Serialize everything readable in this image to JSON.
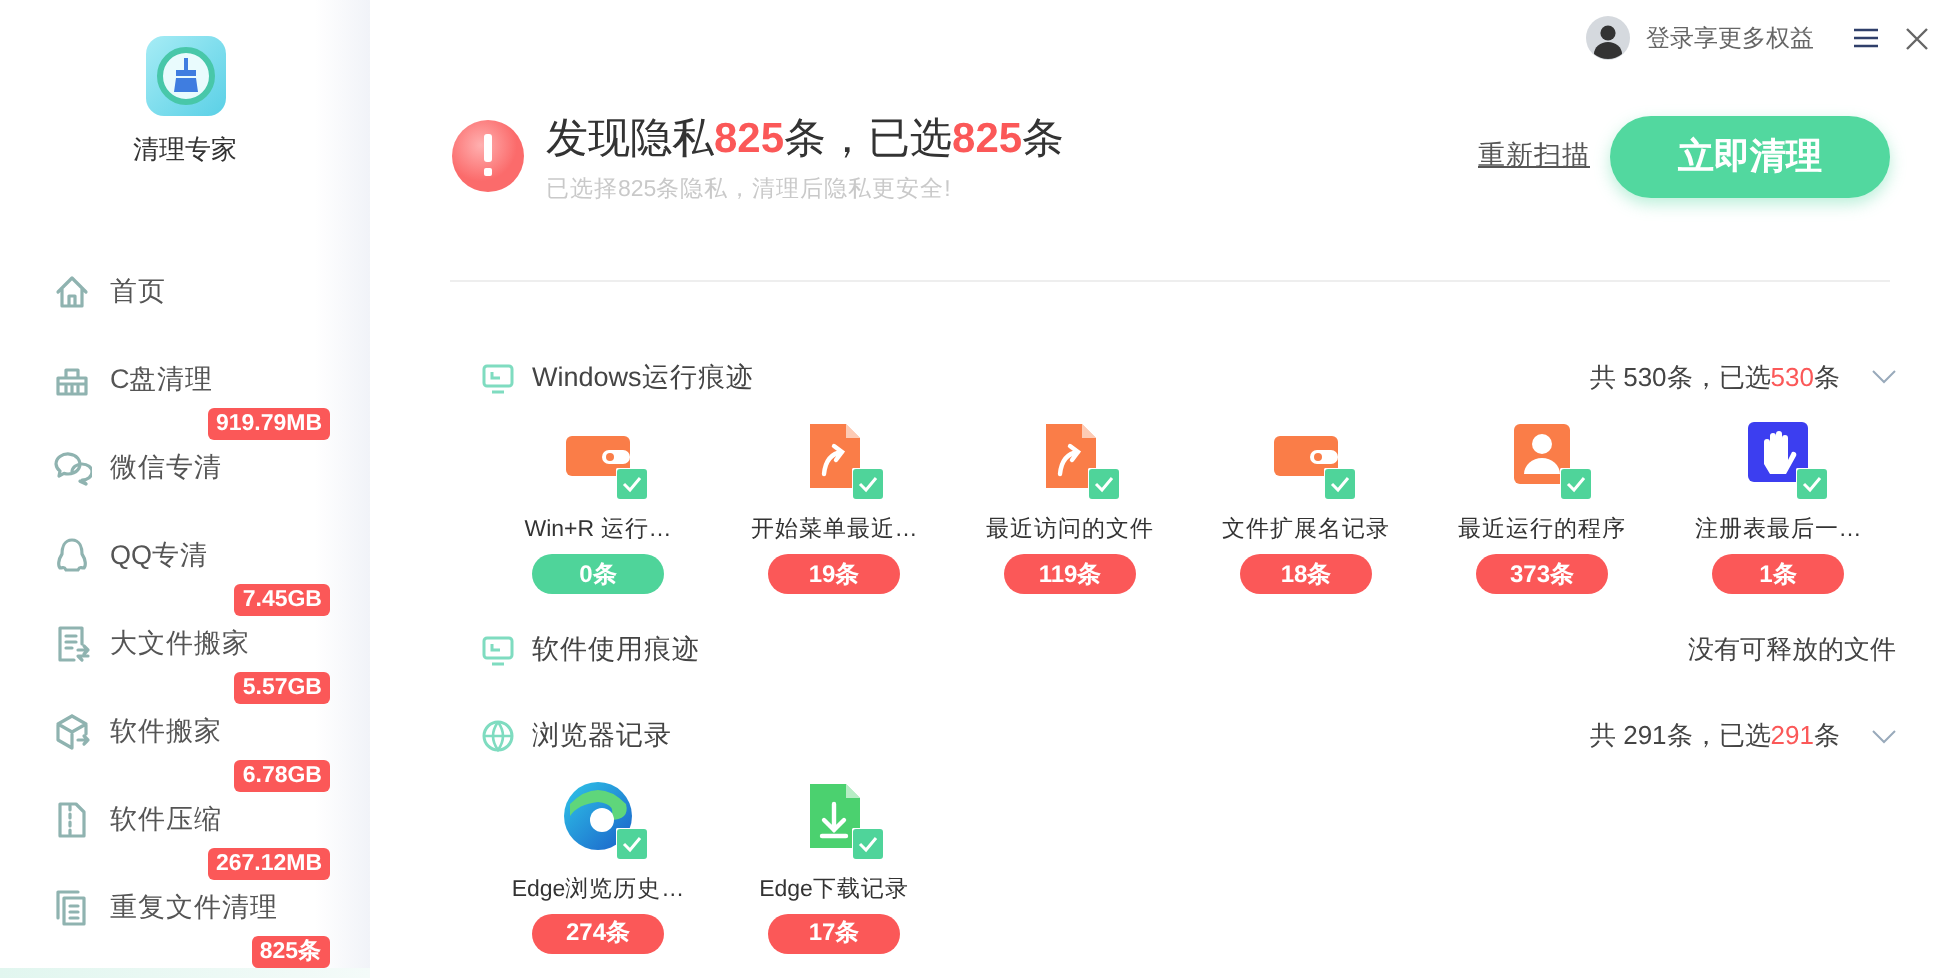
{
  "app": {
    "name": "清理专家"
  },
  "sidebar": {
    "items": [
      {
        "label": "首页",
        "selected": false
      },
      {
        "label": "C盘清理",
        "selected": false
      },
      {
        "label": "微信专清",
        "badge": "919.79MB",
        "selected": false
      },
      {
        "label": "QQ专清",
        "selected": false
      },
      {
        "label": "大文件搬家",
        "badge": "7.45GB",
        "selected": false
      },
      {
        "label": "软件搬家",
        "badge": "5.57GB",
        "selected": false
      },
      {
        "label": "软件压缩",
        "badge": "6.78GB",
        "selected": false
      },
      {
        "label": "重复文件清理",
        "badge": "267.12MB",
        "selected": false
      },
      {
        "badge": "825条",
        "selected": true
      }
    ]
  },
  "top_bar": {
    "login": "登录享更多权益"
  },
  "summary": {
    "title": [
      {
        "kind": "plain",
        "text": "发现隐私"
      },
      {
        "kind": "count",
        "text": "825"
      },
      {
        "kind": "plain",
        "text": "条，已选"
      },
      {
        "kind": "count",
        "text": "825"
      },
      {
        "kind": "plain",
        "text": "条"
      }
    ],
    "subtitle": "已选择825条隐私，清理后隐私更安全!",
    "rescan": "重新扫描",
    "clean": "立即清理"
  },
  "sections": [
    {
      "title": "Windows运行痕迹",
      "status": [
        {
          "kind": "plain",
          "text": "共 530条，已选"
        },
        {
          "kind": "count",
          "text": "530"
        },
        {
          "kind": "plain",
          "text": "条"
        }
      ],
      "items": [
        {
          "label": "Win+R 运行…",
          "checked": true,
          "count": "0条",
          "color": "#4fd49a"
        },
        {
          "label": "开始菜单最近…",
          "checked": true,
          "count": "19条",
          "color": "#fb5858"
        },
        {
          "label": "最近访问的文件",
          "checked": true,
          "count": "119条",
          "color": "#fb5858"
        },
        {
          "label": "文件扩展名记录",
          "checked": true,
          "count": "18条",
          "color": "#fb5858"
        },
        {
          "label": "最近运行的程序",
          "checked": true,
          "count": "373条",
          "color": "#fb5858"
        },
        {
          "label": "注册表最后一…",
          "checked": true,
          "count": "1条",
          "color": "#fb5858"
        }
      ]
    },
    {
      "title": "软件使用痕迹",
      "status": [
        {
          "kind": "plain",
          "text": "没有可释放的文件"
        }
      ]
    },
    {
      "title": "浏览器记录",
      "status": [
        {
          "kind": "plain",
          "text": "共 291条，已选"
        },
        {
          "kind": "count",
          "text": "291"
        },
        {
          "kind": "plain",
          "text": "条"
        }
      ],
      "items": [
        {
          "label": "Edge浏览历史…",
          "checked": true,
          "count": "274条",
          "color": "#fb5858"
        },
        {
          "label": "Edge下载记录",
          "checked": true,
          "count": "17条",
          "color": "#fb5858"
        }
      ]
    }
  ]
}
